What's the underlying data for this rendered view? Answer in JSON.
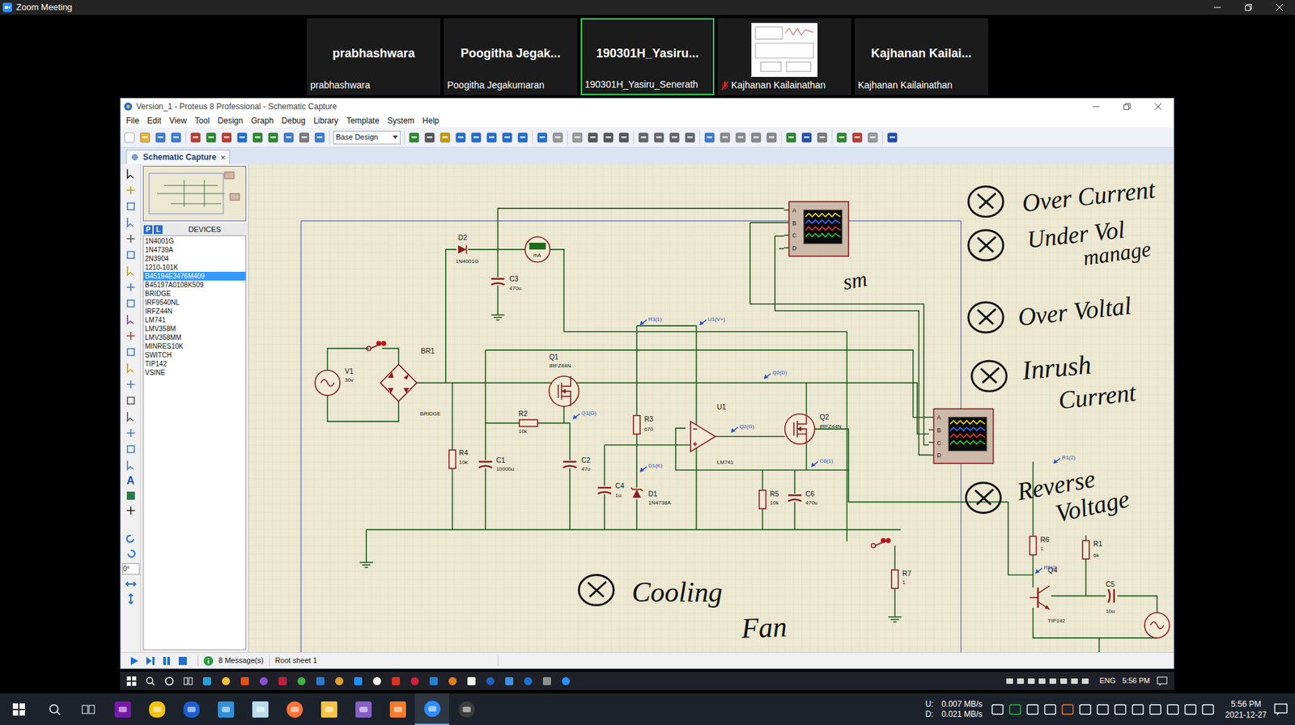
{
  "zoom": {
    "title": "Zoom Meeting"
  },
  "participants": [
    {
      "kind": "name",
      "display": "prabhashwara",
      "name": "prabhashwara",
      "speaking": false,
      "muted": false
    },
    {
      "kind": "name",
      "display": "Poogitha Jegak...",
      "name": "Poogitha Jegakumaran",
      "speaking": false,
      "muted": false
    },
    {
      "kind": "name",
      "display": "190301H_Yasiru...",
      "name": "190301H_Yasiru_Senerath",
      "speaking": true,
      "muted": false
    },
    {
      "kind": "video",
      "display": "",
      "name": "Kajhanan Kailainathan",
      "speaking": false,
      "muted": true
    },
    {
      "kind": "name",
      "display": "Kajhanan Kailai...",
      "name": "Kajhanan Kailainathan",
      "speaking": false,
      "muted": false
    }
  ],
  "proteus": {
    "title": "Version_1 - Proteus 8 Professional - Schematic Capture",
    "menu": [
      "File",
      "Edit",
      "View",
      "Tool",
      "Design",
      "Graph",
      "Debug",
      "Library",
      "Template",
      "System",
      "Help"
    ],
    "design_select": "Base Design",
    "tab": {
      "label": "Schematic Capture",
      "close": "×"
    },
    "tools": {
      "text_tool": "A",
      "rotation": "0°"
    },
    "devices": {
      "p": "P",
      "l": "L",
      "header": "DEVICES",
      "items": [
        {
          "name": "1N4001G",
          "selected": false
        },
        {
          "name": "1N4739A",
          "selected": false
        },
        {
          "name": "2N3904",
          "selected": false
        },
        {
          "name": "1210-101K",
          "selected": false
        },
        {
          "name": "B45194E3476M409",
          "selected": true
        },
        {
          "name": "B45197A0108K509",
          "selected": false
        },
        {
          "name": "BRIDGE",
          "selected": false
        },
        {
          "name": "IRF9540NL",
          "selected": false
        },
        {
          "name": "IRFZ44N",
          "selected": false
        },
        {
          "name": "LM741",
          "selected": false
        },
        {
          "name": "LMV358M",
          "selected": false
        },
        {
          "name": "LMV358MM",
          "selected": false
        },
        {
          "name": "MINRES10K",
          "selected": false
        },
        {
          "name": "SWITCH",
          "selected": false
        },
        {
          "name": "TIP142",
          "selected": false
        },
        {
          "name": "VSINE",
          "selected": false
        }
      ]
    },
    "status": {
      "messages": "8 Message(s)",
      "sheet": "Root sheet 1"
    }
  },
  "schematic": {
    "components": [
      {
        "ref": "V1",
        "value": "30v",
        "kind": "source"
      },
      {
        "ref": "BR1",
        "value": "BRIDGE",
        "kind": "bridge"
      },
      {
        "ref": "D2",
        "value": "1N4001G",
        "kind": "diode"
      },
      {
        "ref": "C3",
        "value": "470u",
        "kind": "cap"
      },
      {
        "ref": "Q1",
        "value": "IRFZ44N",
        "kind": "mosfet"
      },
      {
        "ref": "R2",
        "value": "10k",
        "kind": "res"
      },
      {
        "ref": "R4",
        "value": "10k",
        "kind": "res"
      },
      {
        "ref": "C1",
        "value": "10000u",
        "kind": "cap"
      },
      {
        "ref": "C2",
        "value": "47u",
        "kind": "cap"
      },
      {
        "ref": "C4",
        "value": "1u",
        "kind": "cap"
      },
      {
        "ref": "D1",
        "value": "1N4738A",
        "kind": "zener"
      },
      {
        "ref": "R3",
        "value": "670",
        "kind": "res"
      },
      {
        "ref": "U1",
        "value": "LM741",
        "kind": "opamp"
      },
      {
        "ref": "Q2",
        "value": "IRFZ44N",
        "kind": "mosfet"
      },
      {
        "ref": "R5",
        "value": "10k",
        "kind": "res"
      },
      {
        "ref": "C6",
        "value": "470u",
        "kind": "cap"
      },
      {
        "ref": "R7",
        "value": "1",
        "kind": "res"
      },
      {
        "ref": "R6",
        "value": "1",
        "kind": "res"
      },
      {
        "ref": "R1",
        "value": "6k",
        "kind": "res"
      },
      {
        "ref": "Q4",
        "value": "TIP142",
        "kind": "npn"
      },
      {
        "ref": "C5",
        "value": "10u",
        "kind": "cap"
      },
      {
        "ref": "",
        "value": "mA",
        "kind": "ammeter"
      },
      {
        "ref": "",
        "value": "",
        "kind": "source"
      }
    ],
    "switches": [
      {
        "closed": false
      },
      {
        "closed": false
      }
    ],
    "scopes": [
      {
        "channels": [
          "A",
          "B",
          "C",
          "D"
        ]
      },
      {
        "channels": [
          "A",
          "B",
          "C",
          "D"
        ]
      }
    ],
    "probes": [
      "R3(1)",
      "U1(V+)",
      "Q2(D)",
      "Q1(G)",
      "Q2(G)",
      "D1(K)",
      "C6(1)",
      "R1(2)",
      "R6(2)"
    ],
    "annotations": [
      {
        "lines": [
          "Over Current"
        ],
        "marked": true
      },
      {
        "lines": [
          "Under Vol",
          "manage"
        ],
        "marked": true
      },
      {
        "lines": [
          "Over Voltal"
        ],
        "marked": true
      },
      {
        "lines": [
          "Inrush",
          "Current"
        ],
        "marked": true
      },
      {
        "lines": [
          "Reverse",
          "Voltage"
        ],
        "marked": true
      },
      {
        "lines": [
          "Cooling",
          "Fan"
        ],
        "marked": true
      },
      {
        "lines": [
          "sm"
        ],
        "marked": false
      }
    ]
  },
  "remote_taskbar": {
    "language": "ENG",
    "time": "5:56 PM"
  },
  "taskbar": {
    "upload_label": "U:",
    "upload": "0.007 MB/s",
    "download_label": "D:",
    "download": "0.021 MB/s",
    "time": "5:56 PM",
    "date": "2021-12-27"
  }
}
